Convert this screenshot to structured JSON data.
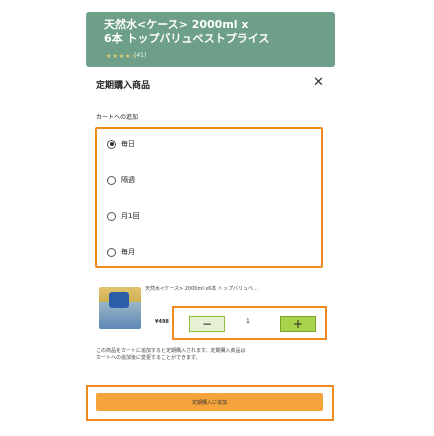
{
  "banner": {
    "title": "天然水<ケース> 2000ml x\n6本 トップバリュベストプライス",
    "stars": "★★★★☆",
    "review_count": "(41)"
  },
  "dialog": {
    "title": "定期購入商品",
    "close_label": "✕",
    "section_label": "カートへの追加"
  },
  "options": [
    {
      "label": "毎日",
      "checked": true
    },
    {
      "label": "隔週",
      "checked": false
    },
    {
      "label": "月1回",
      "checked": false
    },
    {
      "label": "毎月",
      "checked": false
    }
  ],
  "product": {
    "name": "天然水<ケース> 2000ml x6本 トップバリュベ…",
    "price": "¥498"
  },
  "stepper": {
    "minus_label": "−",
    "quantity": "1",
    "plus_label": "+"
  },
  "notice": {
    "line1": "この商品をカートに追加すると定期購入されます。定期購入商品は",
    "line2": "カートへの追加後に変更することができます。"
  },
  "cta": {
    "label": "定期購入に追加"
  },
  "colors": {
    "highlight": "#f08a1c",
    "banner": "#4f8a6e",
    "plus_button": "#a7d34a",
    "cta": "#f5a43c"
  }
}
